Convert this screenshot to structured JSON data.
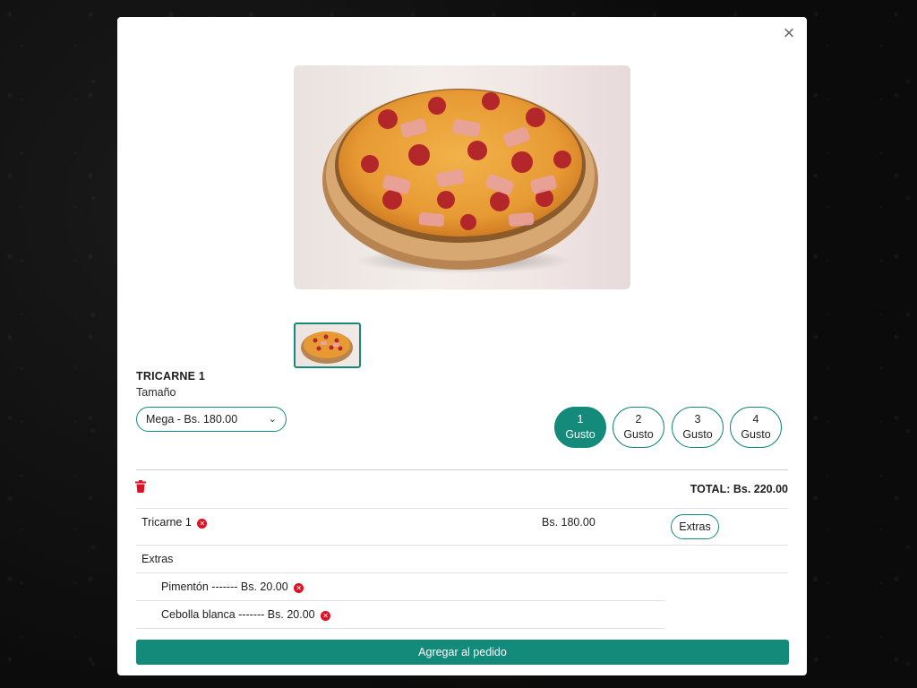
{
  "modal": {
    "close_icon": "close-icon",
    "close_glyph": "×"
  },
  "product": {
    "name": "TRICARNE 1",
    "size_label": "Tamaño",
    "size_selected": "Mega - Bs. 180.00",
    "image_icon": "pizza-image"
  },
  "gustos": [
    {
      "number": "1",
      "label": "Gusto",
      "active": true
    },
    {
      "number": "2",
      "label": "Gusto",
      "active": false
    },
    {
      "number": "3",
      "label": "Gusto",
      "active": false
    },
    {
      "number": "4",
      "label": "Gusto",
      "active": false
    }
  ],
  "order": {
    "total": "TOTAL: Bs. 220.00",
    "item": {
      "name": "Tricarne 1",
      "price": "Bs. 180.00",
      "extras_button": "Extras"
    },
    "extras_header": "Extras",
    "extras": [
      {
        "label": "Pimentón ------- Bs. 20.00"
      },
      {
        "label": "Cebolla blanca ------- Bs. 20.00"
      }
    ]
  },
  "submit_label": "Agregar al pedido",
  "colors": {
    "accent": "#138a7a",
    "remove": "#e01020"
  }
}
